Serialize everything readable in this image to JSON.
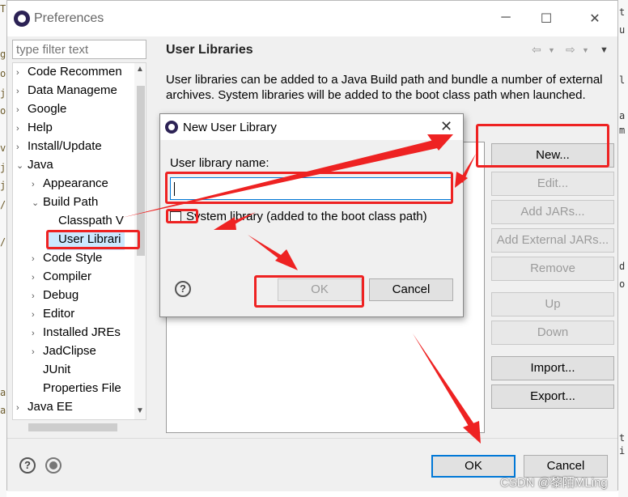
{
  "window": {
    "title": "Preferences",
    "minimize": "─",
    "maximize": "☐",
    "close": "✕"
  },
  "filter_placeholder": "type filter text",
  "tree": [
    {
      "label": "Code Recommen",
      "arrow": "›",
      "indent": 0
    },
    {
      "label": "Data Manageme",
      "arrow": "›",
      "indent": 0
    },
    {
      "label": "Google",
      "arrow": "›",
      "indent": 0
    },
    {
      "label": "Help",
      "arrow": "›",
      "indent": 0
    },
    {
      "label": "Install/Update",
      "arrow": "›",
      "indent": 0
    },
    {
      "label": "Java",
      "arrow": "⌄",
      "indent": 0
    },
    {
      "label": "Appearance",
      "arrow": "›",
      "indent": 1
    },
    {
      "label": "Build Path",
      "arrow": "⌄",
      "indent": 1
    },
    {
      "label": "Classpath V",
      "arrow": "",
      "indent": 2
    },
    {
      "label": "User Librari",
      "arrow": "",
      "indent": 2,
      "selected": true
    },
    {
      "label": "Code Style",
      "arrow": "›",
      "indent": 1
    },
    {
      "label": "Compiler",
      "arrow": "›",
      "indent": 1
    },
    {
      "label": "Debug",
      "arrow": "›",
      "indent": 1
    },
    {
      "label": "Editor",
      "arrow": "›",
      "indent": 1
    },
    {
      "label": "Installed JREs",
      "arrow": "›",
      "indent": 1
    },
    {
      "label": "JadClipse",
      "arrow": "›",
      "indent": 1
    },
    {
      "label": "JUnit",
      "arrow": "",
      "indent": 1
    },
    {
      "label": "Properties File",
      "arrow": "",
      "indent": 1
    },
    {
      "label": "Java EE",
      "arrow": "›",
      "indent": 0
    }
  ],
  "page": {
    "title": "User Libraries",
    "description": "User libraries can be added to a Java Build path and bundle a number of external archives. System libraries will be added to the boot class path when launched.",
    "buttons": {
      "new": "New...",
      "edit": "Edit...",
      "add_jars": "Add JARs...",
      "add_external_jars": "Add External JARs...",
      "remove": "Remove",
      "up": "Up",
      "down": "Down",
      "import": "Import...",
      "export": "Export..."
    }
  },
  "bottom": {
    "ok": "OK",
    "cancel": "Cancel",
    "help": "?"
  },
  "dialog": {
    "title": "New User Library",
    "name_label": "User library name:",
    "name_value": "",
    "system_label": "System library (added to the boot class path)",
    "ok": "OK",
    "cancel": "Cancel",
    "help": "?",
    "close": "✕"
  },
  "watermark": "CSDN @黎陌MLing",
  "colors": {
    "annotation": "#ee2222",
    "focus": "#0078d7",
    "selection": "#cce8ff"
  }
}
